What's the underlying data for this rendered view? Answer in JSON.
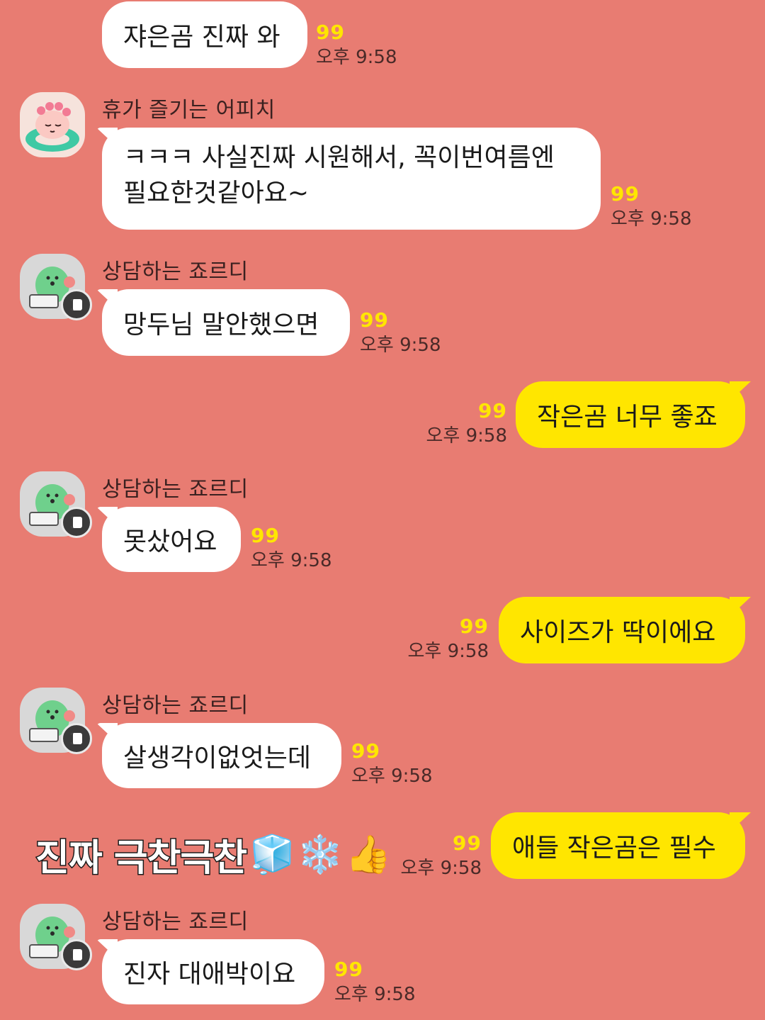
{
  "colors": {
    "background": "#e87c72",
    "incoming_bubble": "#ffffff",
    "outgoing_bubble": "#ffe600",
    "unread_count": "#ffe600"
  },
  "messages": [
    {
      "dir": "in",
      "sender": "",
      "text": "쟈은곰 진짜 와",
      "unread": "99",
      "time": "오후 9:58"
    },
    {
      "dir": "in",
      "sender": "휴가 즐기는 어피치",
      "avatar": "apeach-avatar",
      "text_lines": [
        "ㅋㅋㅋ 사실진짜 시원해서, 꼭이번여름엔",
        "필요한것같아요~"
      ],
      "unread": "99",
      "time": "오후 9:58"
    },
    {
      "dir": "in",
      "sender": "상담하는 죠르디",
      "avatar": "jordy-avatar",
      "text": "망두님 말안했으면",
      "unread": "99",
      "time": "오후 9:58"
    },
    {
      "dir": "out",
      "text": "작은곰 너무 좋죠",
      "unread": "99",
      "time": "오후 9:58"
    },
    {
      "dir": "in",
      "sender": "상담하는 죠르디",
      "avatar": "jordy-avatar",
      "text": "못샀어요",
      "unread": "99",
      "time": "오후 9:58"
    },
    {
      "dir": "out",
      "text": "사이즈가 딱이에요",
      "unread": "99",
      "time": "오후 9:58"
    },
    {
      "dir": "in",
      "sender": "상담하는 죠르디",
      "avatar": "jordy-avatar",
      "text": "살생각이없엇는데",
      "unread": "99",
      "time": "오후 9:58"
    },
    {
      "dir": "out",
      "text": "애들 작은곰은 필수",
      "unread": "99",
      "time": "오후 9:58"
    },
    {
      "dir": "in",
      "sender": "상담하는 죠르디",
      "avatar": "jordy-avatar",
      "text": "진자 대애박이요",
      "unread": "99",
      "time": "오후 9:58"
    }
  ],
  "overlay_caption": {
    "text": "진짜 극찬극찬",
    "emojis": [
      "🧊",
      "❄️",
      "👍"
    ]
  }
}
